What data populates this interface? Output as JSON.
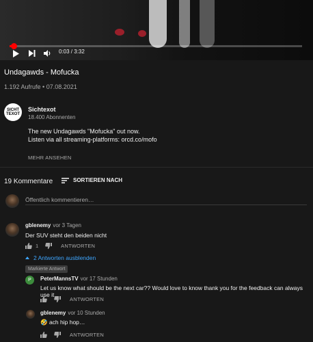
{
  "player": {
    "time": "0:03 / 3:32",
    "progress": 0.015,
    "play_icon": "play-icon",
    "next_icon": "next-icon",
    "volume_icon": "volume-icon"
  },
  "video": {
    "title": "Undagawds - Mofucka",
    "meta": "1.192 Aufrufe • 07.08.2021"
  },
  "channel": {
    "logo_text": "SICHT TEXOT",
    "name": "Sichtexot",
    "subscribers": "18.400 Abonnenten",
    "description_line1": "The new Undagawds \"Mofucka\" out now.",
    "description_line2": "Listen via all streaming-platforms: orcd.co/mofo",
    "show_more": "MEHR ANSEHEN"
  },
  "comments_header": {
    "count": "19 Kommentare",
    "sort_label": "SORTIEREN NACH"
  },
  "composer": {
    "placeholder": "Öffentlich kommentieren…"
  },
  "comments": [
    {
      "author": "gblenemy",
      "ago": "vor 3 Tagen",
      "text": "Der SUV steht den beiden nicht",
      "likes": "1",
      "reply_label": "ANTWORTEN",
      "toggle_replies": "2 Antworten ausblenden"
    }
  ],
  "replies": [
    {
      "badge": "Markierte Antwort",
      "avatar_letter": "P",
      "author": "PeterMannsTV",
      "ago": "vor 17 Stunden",
      "text": "Let us know what should be the next car?? Would love to know thank you for the feedback can always use it",
      "reply_label": "ANTWORTEN"
    },
    {
      "author": "gblenemy",
      "ago": "vor 10 Stunden",
      "text": "🤣 ach hip hop…",
      "reply_label": "ANTWORTEN"
    }
  ],
  "colors": {
    "background": "#181818",
    "accent_red": "#ff0000",
    "link_blue": "#3ea6ff"
  }
}
